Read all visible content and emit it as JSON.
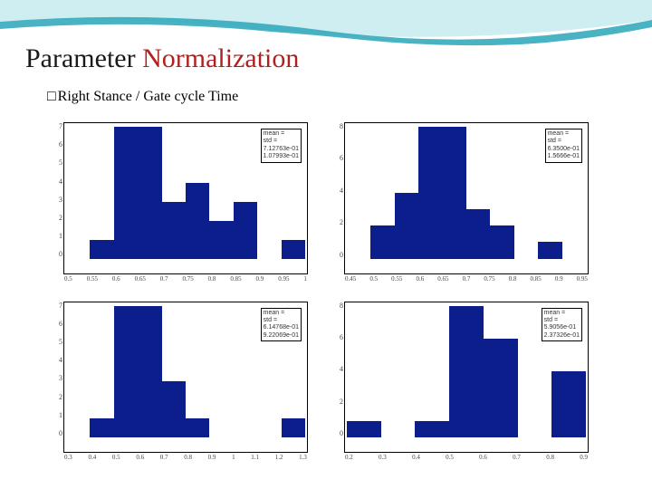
{
  "title_plain": "Parameter",
  "title_accent": " Normalization",
  "subtitle_bullet": "□",
  "subtitle_text": " Right Stance / Gate cycle Time",
  "chart_data": [
    {
      "type": "bar",
      "stats_label_mean": "mean =",
      "stats_label_std": "std =",
      "stats_mean": "7.12763e-01",
      "stats_std": "1.07993e-01",
      "ylim": [
        0,
        7
      ],
      "xlim": [
        0.5,
        1.0
      ],
      "yticks": [
        0,
        1,
        2,
        3,
        4,
        5,
        6,
        7
      ],
      "xticks": [
        0.5,
        0.55,
        0.6,
        0.65,
        0.7,
        0.75,
        0.8,
        0.85,
        0.9,
        0.95,
        1.0
      ],
      "categories": [
        0.525,
        0.575,
        0.625,
        0.675,
        0.725,
        0.775,
        0.825,
        0.875,
        0.925,
        0.975
      ],
      "values": [
        0,
        1,
        7,
        7,
        3,
        4,
        2,
        3,
        0,
        1
      ]
    },
    {
      "type": "bar",
      "stats_label_mean": "mean =",
      "stats_label_std": "std =",
      "stats_mean": "6.3500e-01",
      "stats_std": "1.5666e-01",
      "ylim": [
        0,
        8
      ],
      "xlim": [
        0.45,
        0.95
      ],
      "yticks": [
        0,
        2,
        4,
        6,
        8
      ],
      "xticks": [
        0.45,
        0.5,
        0.55,
        0.6,
        0.65,
        0.7,
        0.75,
        0.8,
        0.85,
        0.9,
        0.95
      ],
      "categories": [
        0.475,
        0.525,
        0.575,
        0.625,
        0.675,
        0.725,
        0.775,
        0.825,
        0.875,
        0.925
      ],
      "values": [
        0,
        2,
        4,
        8,
        8,
        3,
        2,
        0,
        1,
        0
      ]
    },
    {
      "type": "bar",
      "stats_label_mean": "mean =",
      "stats_label_std": "std =",
      "stats_mean": "6.14768e-01",
      "stats_std": "9.22069e-01",
      "ylim": [
        0,
        7
      ],
      "xlim": [
        0.3,
        1.3
      ],
      "yticks": [
        0,
        1,
        2,
        3,
        4,
        5,
        6,
        7
      ],
      "xticks": [
        0.3,
        0.4,
        0.5,
        0.6,
        0.7,
        0.8,
        0.9,
        1.0,
        1.1,
        1.2,
        1.3
      ],
      "categories": [
        0.35,
        0.45,
        0.55,
        0.65,
        0.75,
        0.85,
        0.95,
        1.05,
        1.15,
        1.25
      ],
      "values": [
        0,
        1,
        7,
        7,
        3,
        1,
        0,
        0,
        0,
        1
      ]
    },
    {
      "type": "bar",
      "stats_label_mean": "mean =",
      "stats_label_std": "std =",
      "stats_mean": "5.9056e-01",
      "stats_std": "2.37326e-01",
      "ylim": [
        0,
        8
      ],
      "xlim": [
        0.2,
        0.9
      ],
      "yticks": [
        0,
        2,
        4,
        6,
        8
      ],
      "xticks": [
        0.2,
        0.3,
        0.4,
        0.5,
        0.6,
        0.7,
        0.8,
        0.9
      ],
      "categories": [
        0.25,
        0.35,
        0.45,
        0.55,
        0.65,
        0.75,
        0.85
      ],
      "values": [
        1,
        0,
        1,
        8,
        6,
        0,
        4
      ]
    }
  ]
}
